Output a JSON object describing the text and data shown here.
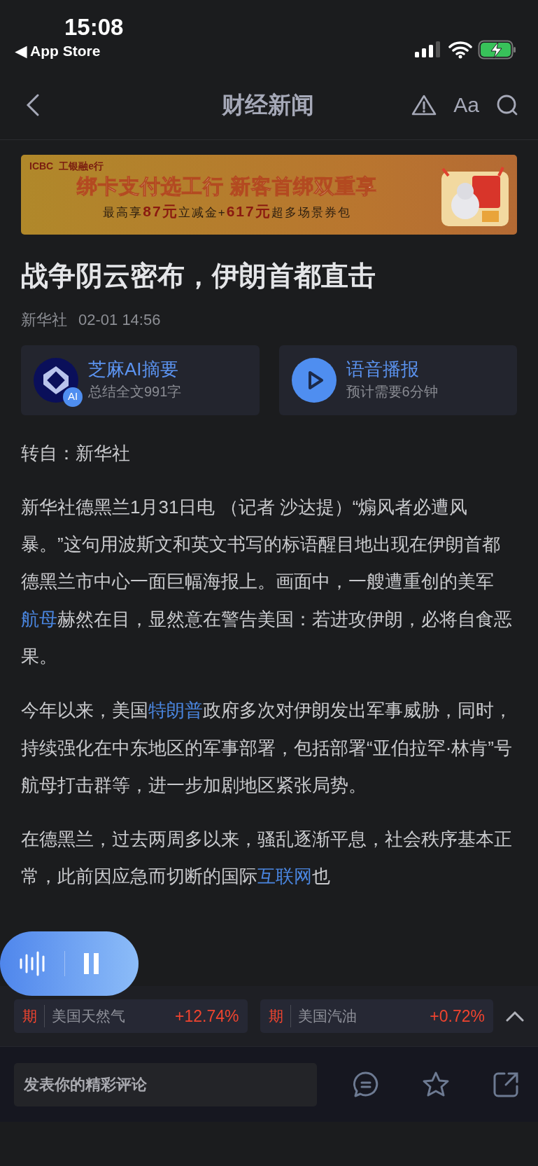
{
  "status_bar": {
    "time": "15:08",
    "back_app": "◀ App Store"
  },
  "header": {
    "title": "财经新闻",
    "font_button": "Aa"
  },
  "ad": {
    "bank_logo": "ICBC",
    "bank_name": "工银融e行",
    "headline": "绑卡支付选工行  新客首绑双重享",
    "offer": "最高享**87元**立减金+**617元**超多场景券包"
  },
  "article": {
    "title": "战争阴云密布，伊朗首都直击",
    "source": "新华社",
    "time": "02-01 14:56",
    "tools": [
      {
        "kind": "ai",
        "title": "芝麻AI摘要",
        "subtitle": "总结全文991字",
        "badge": "AI"
      },
      {
        "kind": "audio",
        "title": "语音播报",
        "subtitle": "预计需要6分钟"
      }
    ],
    "repost": "转自：新华社",
    "paragraphs": [
      [
        {
          "text": "新华社德黑兰1月31日电 （记者 沙达提）“煽风者必遭风暴。”这句用波斯文和英文书写的标语醒目地出现在伊朗首都德黑兰市中心一面巨幅海报上。画面中，一艘遭重创的美军"
        },
        {
          "text": "航母",
          "link": true
        },
        {
          "text": "赫然在目，显然意在警告美国：若进攻伊朗，必将自食恶果。"
        }
      ],
      [
        {
          "text": "今年以来，美国"
        },
        {
          "text": "特朗普",
          "link": true
        },
        {
          "text": "政府多次对伊朗发出军事威胁，同时，持续强化在中东地区的军事部署，包括部署“亚伯拉罕·林肯”号航母打击群等，进一步加剧地区紧张局势。"
        }
      ],
      [
        {
          "text": "在德黑兰，过去两周多以来，骚乱逐渐平息，社会秩序基本正常，此前因应急而切断的国际"
        },
        {
          "text": "互联网",
          "link": true
        },
        {
          "text": "也"
        }
      ]
    ]
  },
  "player": {
    "playing": true
  },
  "tickers": [
    {
      "tag": "期",
      "name": "美国天然气",
      "change": "+12.74%"
    },
    {
      "tag": "期",
      "name": "美国汽油",
      "change": "+0.72%"
    }
  ],
  "comment": {
    "placeholder": "发表你的精彩评论"
  }
}
